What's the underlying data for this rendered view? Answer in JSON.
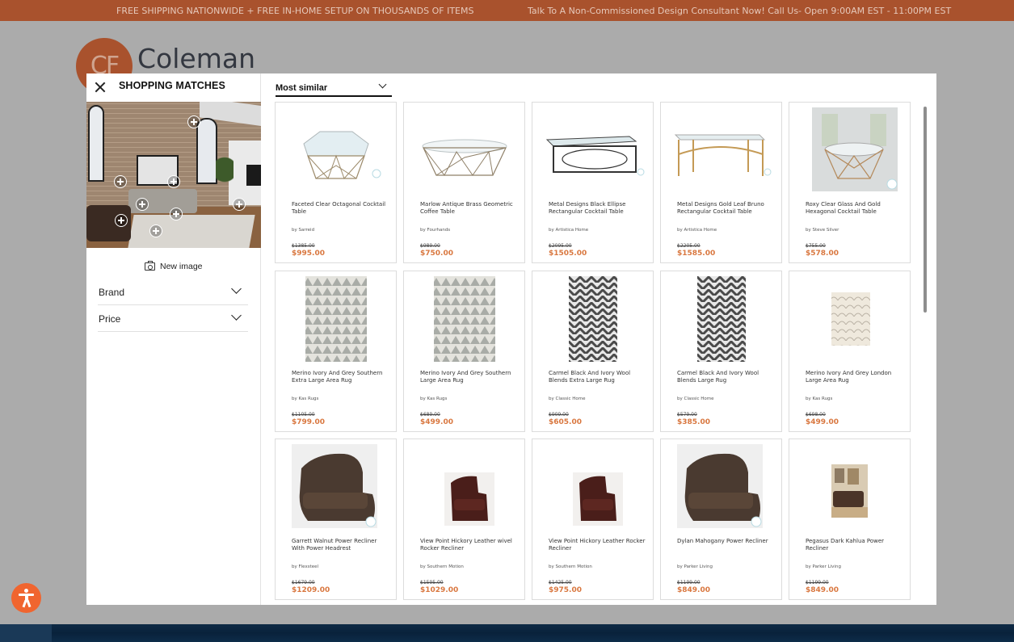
{
  "promo": {
    "left_text": "FREE SHIPPING NATIONWIDE + FREE IN-HOME SETUP ON THOUSANDS OF ITEMS",
    "right_text": "Talk To A Non-Commissioned Design Consultant Now! Call Us- Open 9:00AM EST - 11:00PM EST"
  },
  "logo": {
    "monogram": "CF",
    "name": "Coleman"
  },
  "colors": {
    "brand": "#a9522d",
    "price": "#d9773f",
    "accessibility": "#f0652f"
  },
  "sidebar": {
    "title": "SHOPPING MATCHES",
    "close_icon": "close-icon",
    "new_image_label": "New image",
    "filters": [
      {
        "label": "Brand"
      },
      {
        "label": "Price"
      }
    ]
  },
  "main": {
    "sort_label": "Most similar",
    "products": [
      {
        "name": "Faceted Clear Octagonal Cocktail Table",
        "brand": "by Sarreid",
        "original_price": "$1385.00",
        "price": "$995.00",
        "kind": "table-octagon"
      },
      {
        "name": "Marlow Antique Brass Geometric Coffee Table",
        "brand": "by Fourhands",
        "original_price": "$989.00",
        "price": "$750.00",
        "kind": "table-geo"
      },
      {
        "name": "Metal Designs Black Ellipse Rectangular Cocktail Table",
        "brand": "by Artistica Home",
        "original_price": "$2095.00",
        "price": "$1505.00",
        "kind": "table-black"
      },
      {
        "name": "Metal Designs Gold Leaf Bruno Rectangular Cocktail Table",
        "brand": "by Artistica Home",
        "original_price": "$2205.00",
        "price": "$1585.00",
        "kind": "table-gold"
      },
      {
        "name": "Roxy Clear Glass And Gold Hexagonal Cocktail Table",
        "brand": "by Steve Silver",
        "original_price": "$755.00",
        "price": "$578.00",
        "kind": "table-hex"
      },
      {
        "name": "Merino Ivory And Grey Southern Extra Large Area Rug",
        "brand": "by Kas Rugs",
        "original_price": "$1105.00",
        "price": "$799.00",
        "kind": "rug-ivory"
      },
      {
        "name": "Merino Ivory And Grey Southern Large Area Rug",
        "brand": "by Kas Rugs",
        "original_price": "$689.00",
        "price": "$499.00",
        "kind": "rug-ivory"
      },
      {
        "name": "Carmel Black And Ivory Wool Blends Extra Large Rug",
        "brand": "by Classic Home",
        "original_price": "$909.00",
        "price": "$605.00",
        "kind": "rug-chevron"
      },
      {
        "name": "Carmel Black And Ivory Wool Blends Large Rug",
        "brand": "by Classic Home",
        "original_price": "$579.00",
        "price": "$385.00",
        "kind": "rug-chevron"
      },
      {
        "name": "Merino Ivory And Grey London Large Area Rug",
        "brand": "by Kas Rugs",
        "original_price": "$698.00",
        "price": "$499.00",
        "kind": "rug-london"
      },
      {
        "name": "Garrett Walnut Power Recliner With Power Headrest",
        "brand": "by Flexsteel",
        "original_price": "$1679.00",
        "price": "$1209.00",
        "kind": "recliner-big"
      },
      {
        "name": "View Point Hickory Leather wivel Rocker Recliner",
        "brand": "by Southern Motion",
        "original_price": "$1595.00",
        "price": "$1029.00",
        "kind": "recliner-small"
      },
      {
        "name": "View Point Hickory Leather Rocker Recliner",
        "brand": "by Southern Motion",
        "original_price": "$1425.00",
        "price": "$975.00",
        "kind": "recliner-small"
      },
      {
        "name": "Dylan Mahogany Power Recliner",
        "brand": "by Parker Living",
        "original_price": "$1199.00",
        "price": "$849.00",
        "kind": "recliner-big"
      },
      {
        "name": "Pegasus Dark Kahlua Power Recliner",
        "brand": "by Parker Living",
        "original_price": "$1199.00",
        "price": "$849.00",
        "kind": "recliner-room"
      }
    ]
  }
}
